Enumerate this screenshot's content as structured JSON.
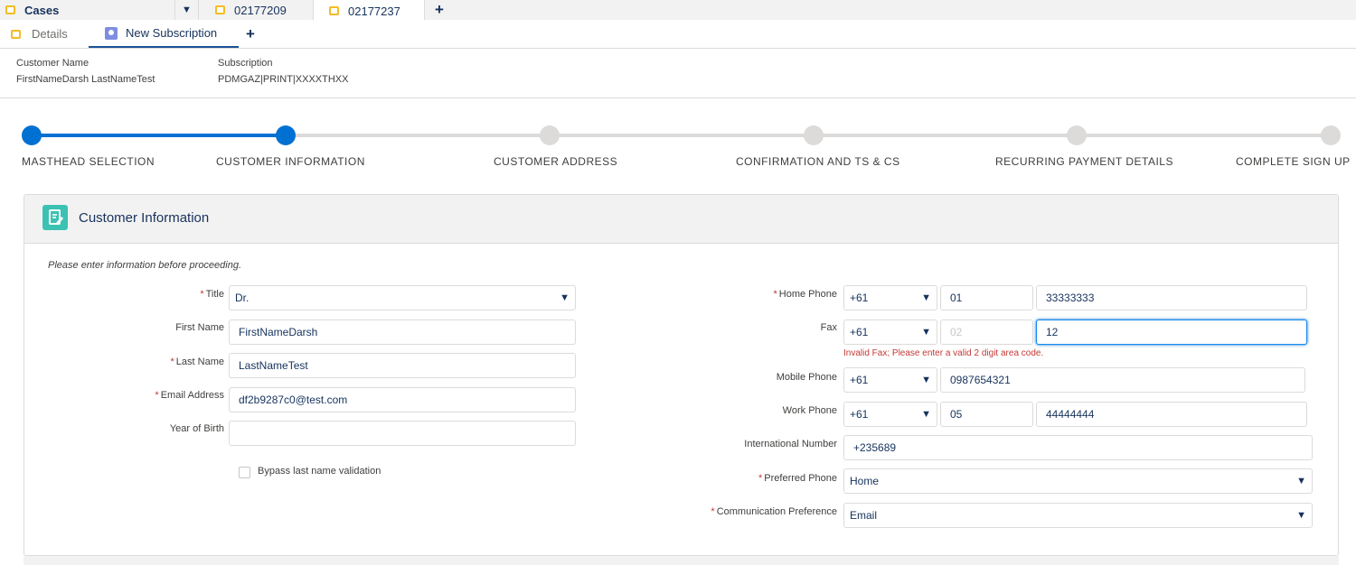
{
  "workspace_tabs": {
    "cases_label": "Cases",
    "tab1": "02177209",
    "tab2": "02177237",
    "add_symbol": "+"
  },
  "sub_tabs": {
    "details": "Details",
    "new_subscription": "New Subscription",
    "add_symbol": "+"
  },
  "header": {
    "customer_name_label": "Customer Name",
    "customer_name_value": "FirstNameDarsh LastNameTest",
    "subscription_label": "Subscription",
    "subscription_value": "PDMGAZ|PRINT|XXXXTHXX"
  },
  "path": {
    "steps": [
      "MASTHEAD SELECTION",
      "CUSTOMER INFORMATION",
      "CUSTOMER ADDRESS",
      "CONFIRMATION AND TS & CS",
      "RECURRING PAYMENT DETAILS",
      "COMPLETE SIGN UP"
    ],
    "completed_steps": 2,
    "accent_color": "#0070d2"
  },
  "card": {
    "title": "Customer Information",
    "hint": "Please enter information before proceeding."
  },
  "left_form": {
    "title_label": "Title",
    "title_value": "Dr.",
    "first_name_label": "First Name",
    "first_name_value": "FirstNameDarsh",
    "last_name_label": "Last Name",
    "last_name_value": "LastNameTest",
    "email_label": "Email Address",
    "email_value": "df2b9287c0@test.com",
    "yob_label": "Year of Birth",
    "yob_value": "",
    "bypass_label": "Bypass last name validation"
  },
  "right_form": {
    "home_phone_label": "Home Phone",
    "home_phone_country": "+61",
    "home_phone_area": "01",
    "home_phone_number": "33333333",
    "fax_label": "Fax",
    "fax_country": "+61",
    "fax_area_placeholder": "02",
    "fax_number": "12",
    "fax_error": "Invalid Fax; Please enter a valid 2 digit area code.",
    "mobile_label": "Mobile Phone",
    "mobile_country": "+61",
    "mobile_number": "0987654321",
    "work_label": "Work Phone",
    "work_country": "+61",
    "work_area": "05",
    "work_number": "44444444",
    "intl_label": "International Number",
    "intl_value": "+235689",
    "preferred_label": "Preferred Phone",
    "preferred_value": "Home",
    "comm_label": "Communication Preference",
    "comm_value": "Email"
  },
  "required_marker": "*",
  "caret_symbol": "▼",
  "colors": {
    "error": "#c23934",
    "focus_border": "#1589ee",
    "card_icon": "#3cc2b3"
  }
}
